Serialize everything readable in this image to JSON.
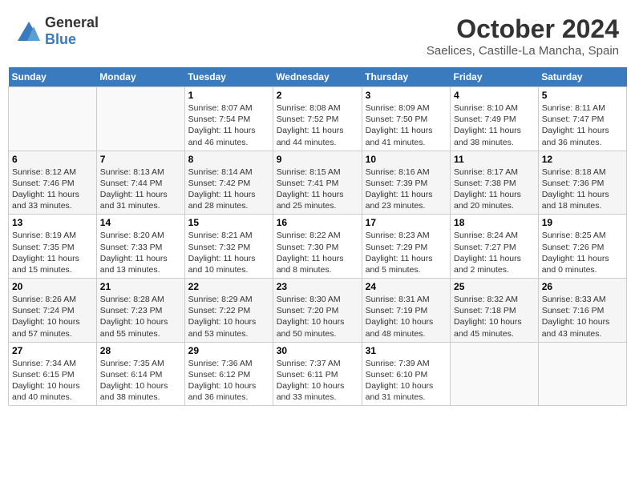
{
  "logo": {
    "general": "General",
    "blue": "Blue"
  },
  "title": "October 2024",
  "subtitle": "Saelices, Castille-La Mancha, Spain",
  "days_of_week": [
    "Sunday",
    "Monday",
    "Tuesday",
    "Wednesday",
    "Thursday",
    "Friday",
    "Saturday"
  ],
  "weeks": [
    [
      {
        "day": "",
        "content": ""
      },
      {
        "day": "",
        "content": ""
      },
      {
        "day": "1",
        "content": "Sunrise: 8:07 AM\nSunset: 7:54 PM\nDaylight: 11 hours and 46 minutes."
      },
      {
        "day": "2",
        "content": "Sunrise: 8:08 AM\nSunset: 7:52 PM\nDaylight: 11 hours and 44 minutes."
      },
      {
        "day": "3",
        "content": "Sunrise: 8:09 AM\nSunset: 7:50 PM\nDaylight: 11 hours and 41 minutes."
      },
      {
        "day": "4",
        "content": "Sunrise: 8:10 AM\nSunset: 7:49 PM\nDaylight: 11 hours and 38 minutes."
      },
      {
        "day": "5",
        "content": "Sunrise: 8:11 AM\nSunset: 7:47 PM\nDaylight: 11 hours and 36 minutes."
      }
    ],
    [
      {
        "day": "6",
        "content": "Sunrise: 8:12 AM\nSunset: 7:46 PM\nDaylight: 11 hours and 33 minutes."
      },
      {
        "day": "7",
        "content": "Sunrise: 8:13 AM\nSunset: 7:44 PM\nDaylight: 11 hours and 31 minutes."
      },
      {
        "day": "8",
        "content": "Sunrise: 8:14 AM\nSunset: 7:42 PM\nDaylight: 11 hours and 28 minutes."
      },
      {
        "day": "9",
        "content": "Sunrise: 8:15 AM\nSunset: 7:41 PM\nDaylight: 11 hours and 25 minutes."
      },
      {
        "day": "10",
        "content": "Sunrise: 8:16 AM\nSunset: 7:39 PM\nDaylight: 11 hours and 23 minutes."
      },
      {
        "day": "11",
        "content": "Sunrise: 8:17 AM\nSunset: 7:38 PM\nDaylight: 11 hours and 20 minutes."
      },
      {
        "day": "12",
        "content": "Sunrise: 8:18 AM\nSunset: 7:36 PM\nDaylight: 11 hours and 18 minutes."
      }
    ],
    [
      {
        "day": "13",
        "content": "Sunrise: 8:19 AM\nSunset: 7:35 PM\nDaylight: 11 hours and 15 minutes."
      },
      {
        "day": "14",
        "content": "Sunrise: 8:20 AM\nSunset: 7:33 PM\nDaylight: 11 hours and 13 minutes."
      },
      {
        "day": "15",
        "content": "Sunrise: 8:21 AM\nSunset: 7:32 PM\nDaylight: 11 hours and 10 minutes."
      },
      {
        "day": "16",
        "content": "Sunrise: 8:22 AM\nSunset: 7:30 PM\nDaylight: 11 hours and 8 minutes."
      },
      {
        "day": "17",
        "content": "Sunrise: 8:23 AM\nSunset: 7:29 PM\nDaylight: 11 hours and 5 minutes."
      },
      {
        "day": "18",
        "content": "Sunrise: 8:24 AM\nSunset: 7:27 PM\nDaylight: 11 hours and 2 minutes."
      },
      {
        "day": "19",
        "content": "Sunrise: 8:25 AM\nSunset: 7:26 PM\nDaylight: 11 hours and 0 minutes."
      }
    ],
    [
      {
        "day": "20",
        "content": "Sunrise: 8:26 AM\nSunset: 7:24 PM\nDaylight: 10 hours and 57 minutes."
      },
      {
        "day": "21",
        "content": "Sunrise: 8:28 AM\nSunset: 7:23 PM\nDaylight: 10 hours and 55 minutes."
      },
      {
        "day": "22",
        "content": "Sunrise: 8:29 AM\nSunset: 7:22 PM\nDaylight: 10 hours and 53 minutes."
      },
      {
        "day": "23",
        "content": "Sunrise: 8:30 AM\nSunset: 7:20 PM\nDaylight: 10 hours and 50 minutes."
      },
      {
        "day": "24",
        "content": "Sunrise: 8:31 AM\nSunset: 7:19 PM\nDaylight: 10 hours and 48 minutes."
      },
      {
        "day": "25",
        "content": "Sunrise: 8:32 AM\nSunset: 7:18 PM\nDaylight: 10 hours and 45 minutes."
      },
      {
        "day": "26",
        "content": "Sunrise: 8:33 AM\nSunset: 7:16 PM\nDaylight: 10 hours and 43 minutes."
      }
    ],
    [
      {
        "day": "27",
        "content": "Sunrise: 7:34 AM\nSunset: 6:15 PM\nDaylight: 10 hours and 40 minutes."
      },
      {
        "day": "28",
        "content": "Sunrise: 7:35 AM\nSunset: 6:14 PM\nDaylight: 10 hours and 38 minutes."
      },
      {
        "day": "29",
        "content": "Sunrise: 7:36 AM\nSunset: 6:12 PM\nDaylight: 10 hours and 36 minutes."
      },
      {
        "day": "30",
        "content": "Sunrise: 7:37 AM\nSunset: 6:11 PM\nDaylight: 10 hours and 33 minutes."
      },
      {
        "day": "31",
        "content": "Sunrise: 7:39 AM\nSunset: 6:10 PM\nDaylight: 10 hours and 31 minutes."
      },
      {
        "day": "",
        "content": ""
      },
      {
        "day": "",
        "content": ""
      }
    ]
  ]
}
